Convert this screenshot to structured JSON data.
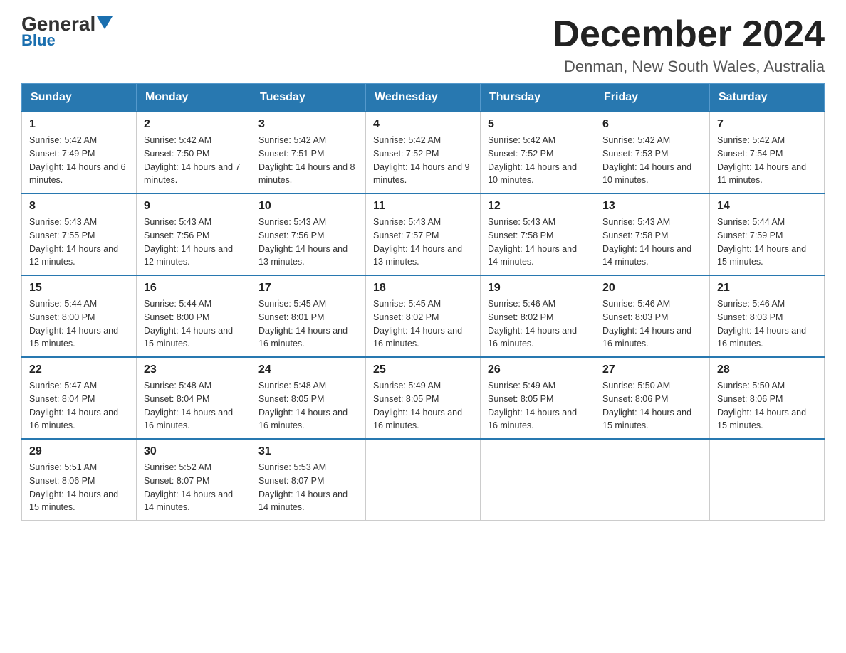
{
  "logo": {
    "line1": "General",
    "triangle": "▶",
    "line2": "Blue"
  },
  "header": {
    "title": "December 2024",
    "subtitle": "Denman, New South Wales, Australia"
  },
  "weekdays": [
    "Sunday",
    "Monday",
    "Tuesday",
    "Wednesday",
    "Thursday",
    "Friday",
    "Saturday"
  ],
  "weeks": [
    [
      {
        "day": "1",
        "sunrise": "5:42 AM",
        "sunset": "7:49 PM",
        "daylight": "14 hours and 6 minutes."
      },
      {
        "day": "2",
        "sunrise": "5:42 AM",
        "sunset": "7:50 PM",
        "daylight": "14 hours and 7 minutes."
      },
      {
        "day": "3",
        "sunrise": "5:42 AM",
        "sunset": "7:51 PM",
        "daylight": "14 hours and 8 minutes."
      },
      {
        "day": "4",
        "sunrise": "5:42 AM",
        "sunset": "7:52 PM",
        "daylight": "14 hours and 9 minutes."
      },
      {
        "day": "5",
        "sunrise": "5:42 AM",
        "sunset": "7:52 PM",
        "daylight": "14 hours and 10 minutes."
      },
      {
        "day": "6",
        "sunrise": "5:42 AM",
        "sunset": "7:53 PM",
        "daylight": "14 hours and 10 minutes."
      },
      {
        "day": "7",
        "sunrise": "5:42 AM",
        "sunset": "7:54 PM",
        "daylight": "14 hours and 11 minutes."
      }
    ],
    [
      {
        "day": "8",
        "sunrise": "5:43 AM",
        "sunset": "7:55 PM",
        "daylight": "14 hours and 12 minutes."
      },
      {
        "day": "9",
        "sunrise": "5:43 AM",
        "sunset": "7:56 PM",
        "daylight": "14 hours and 12 minutes."
      },
      {
        "day": "10",
        "sunrise": "5:43 AM",
        "sunset": "7:56 PM",
        "daylight": "14 hours and 13 minutes."
      },
      {
        "day": "11",
        "sunrise": "5:43 AM",
        "sunset": "7:57 PM",
        "daylight": "14 hours and 13 minutes."
      },
      {
        "day": "12",
        "sunrise": "5:43 AM",
        "sunset": "7:58 PM",
        "daylight": "14 hours and 14 minutes."
      },
      {
        "day": "13",
        "sunrise": "5:43 AM",
        "sunset": "7:58 PM",
        "daylight": "14 hours and 14 minutes."
      },
      {
        "day": "14",
        "sunrise": "5:44 AM",
        "sunset": "7:59 PM",
        "daylight": "14 hours and 15 minutes."
      }
    ],
    [
      {
        "day": "15",
        "sunrise": "5:44 AM",
        "sunset": "8:00 PM",
        "daylight": "14 hours and 15 minutes."
      },
      {
        "day": "16",
        "sunrise": "5:44 AM",
        "sunset": "8:00 PM",
        "daylight": "14 hours and 15 minutes."
      },
      {
        "day": "17",
        "sunrise": "5:45 AM",
        "sunset": "8:01 PM",
        "daylight": "14 hours and 16 minutes."
      },
      {
        "day": "18",
        "sunrise": "5:45 AM",
        "sunset": "8:02 PM",
        "daylight": "14 hours and 16 minutes."
      },
      {
        "day": "19",
        "sunrise": "5:46 AM",
        "sunset": "8:02 PM",
        "daylight": "14 hours and 16 minutes."
      },
      {
        "day": "20",
        "sunrise": "5:46 AM",
        "sunset": "8:03 PM",
        "daylight": "14 hours and 16 minutes."
      },
      {
        "day": "21",
        "sunrise": "5:46 AM",
        "sunset": "8:03 PM",
        "daylight": "14 hours and 16 minutes."
      }
    ],
    [
      {
        "day": "22",
        "sunrise": "5:47 AM",
        "sunset": "8:04 PM",
        "daylight": "14 hours and 16 minutes."
      },
      {
        "day": "23",
        "sunrise": "5:48 AM",
        "sunset": "8:04 PM",
        "daylight": "14 hours and 16 minutes."
      },
      {
        "day": "24",
        "sunrise": "5:48 AM",
        "sunset": "8:05 PM",
        "daylight": "14 hours and 16 minutes."
      },
      {
        "day": "25",
        "sunrise": "5:49 AM",
        "sunset": "8:05 PM",
        "daylight": "14 hours and 16 minutes."
      },
      {
        "day": "26",
        "sunrise": "5:49 AM",
        "sunset": "8:05 PM",
        "daylight": "14 hours and 16 minutes."
      },
      {
        "day": "27",
        "sunrise": "5:50 AM",
        "sunset": "8:06 PM",
        "daylight": "14 hours and 15 minutes."
      },
      {
        "day": "28",
        "sunrise": "5:50 AM",
        "sunset": "8:06 PM",
        "daylight": "14 hours and 15 minutes."
      }
    ],
    [
      {
        "day": "29",
        "sunrise": "5:51 AM",
        "sunset": "8:06 PM",
        "daylight": "14 hours and 15 minutes."
      },
      {
        "day": "30",
        "sunrise": "5:52 AM",
        "sunset": "8:07 PM",
        "daylight": "14 hours and 14 minutes."
      },
      {
        "day": "31",
        "sunrise": "5:53 AM",
        "sunset": "8:07 PM",
        "daylight": "14 hours and 14 minutes."
      },
      null,
      null,
      null,
      null
    ]
  ]
}
